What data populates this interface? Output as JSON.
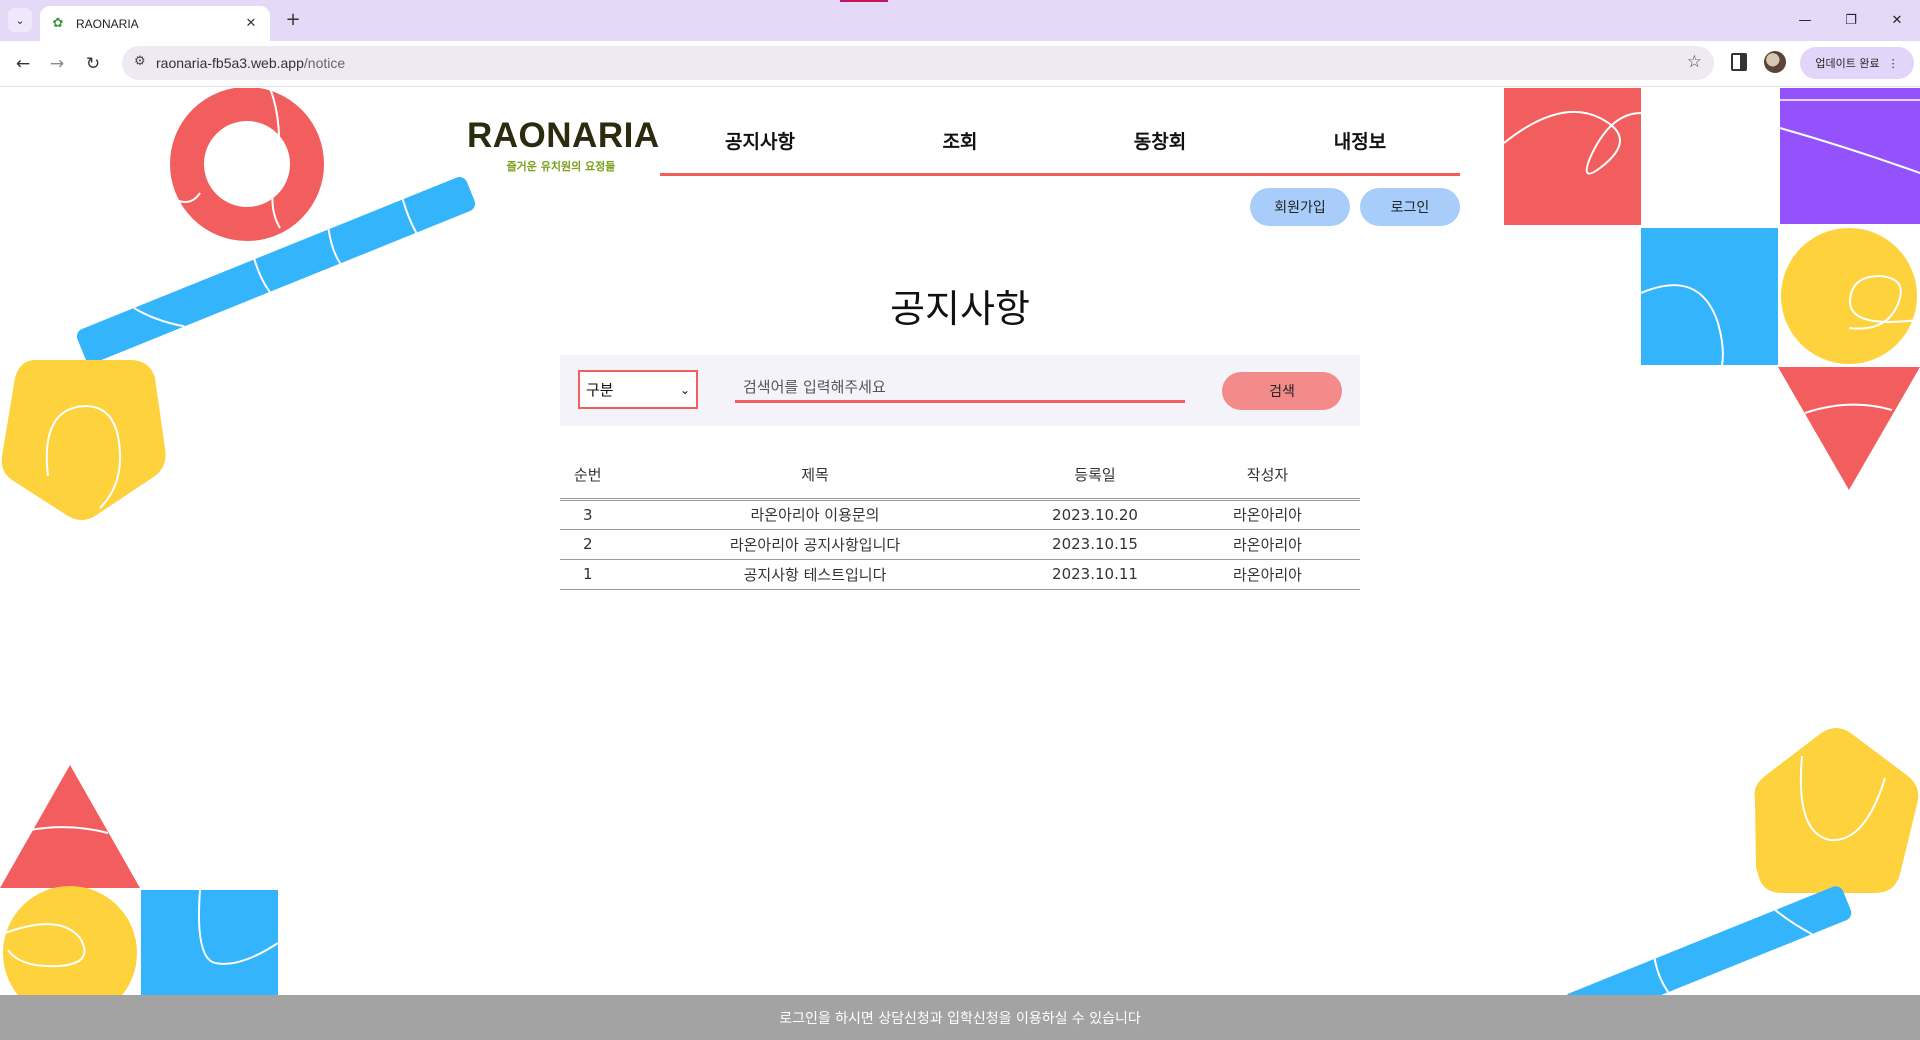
{
  "browser": {
    "tab_title": "RAONARIA",
    "url_host": "raonaria-fb5a3.web.app",
    "url_path": "/notice",
    "update_label": "업데이트 완료",
    "accent": "#e4d9f7"
  },
  "header": {
    "logo": "RAONARIA",
    "tagline": "즐거운 유치원의 요정들",
    "nav": [
      "공지사항",
      "조회",
      "동창회",
      "내정보"
    ],
    "signup": "회원가입",
    "login": "로그인"
  },
  "main": {
    "title": "공지사항",
    "search": {
      "category_selected": "구분",
      "placeholder": "검색어를 입력해주세요",
      "button": "검색"
    },
    "table": {
      "columns": [
        "순번",
        "제목",
        "등록일",
        "작성자"
      ],
      "rows": [
        {
          "num": "3",
          "title": "라온아리아 이용문의",
          "date": "2023.10.20",
          "author": "라온아리아"
        },
        {
          "num": "2",
          "title": "라온아리아 공지사항입니다",
          "date": "2023.10.15",
          "author": "라온아리아"
        },
        {
          "num": "1",
          "title": "공지사항 테스트입니다",
          "date": "2023.10.11",
          "author": "라온아리아"
        }
      ]
    }
  },
  "footer": {
    "notice": "로그인을 하시면 상담신청과 입학신청을 이용하실 수 있습니다"
  },
  "colors": {
    "red": "#f25d5d",
    "blue": "#34b4fb",
    "yellow": "#fdd23d",
    "purple": "#9352fc",
    "button_blue": "#a8cdfb",
    "search_button": "#f48b8b"
  }
}
